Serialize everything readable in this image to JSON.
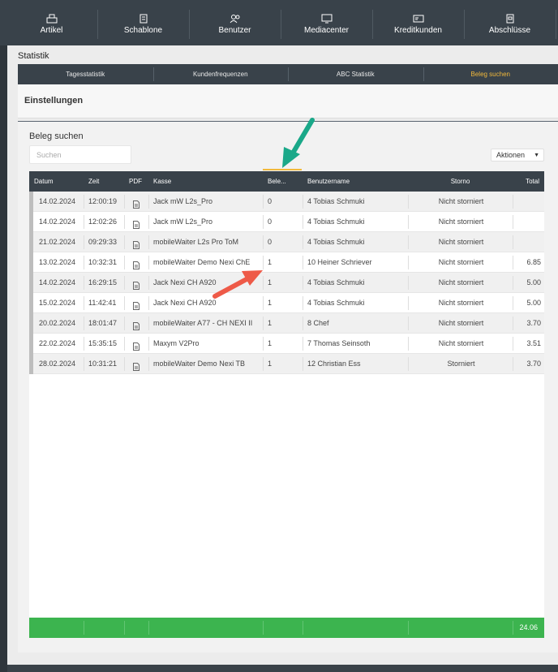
{
  "nav": [
    {
      "label": "Artikel",
      "icon": "register-icon"
    },
    {
      "label": "Schablone",
      "icon": "template-icon"
    },
    {
      "label": "Benutzer",
      "icon": "users-icon"
    },
    {
      "label": "Mediacenter",
      "icon": "media-icon"
    },
    {
      "label": "Kreditkunden",
      "icon": "id-card-icon"
    },
    {
      "label": "Abschlüsse",
      "icon": "report-icon"
    }
  ],
  "page_title": "Statistik",
  "tabs": [
    "Tagesstatistik",
    "Kundenfrequenzen",
    "ABC Statistik",
    "Beleg suchen"
  ],
  "active_tab": "Beleg suchen",
  "settings_title": "Einstellungen",
  "section_title": "Beleg suchen",
  "search_placeholder": "Suchen",
  "actions_label": "Aktionen",
  "columns": [
    "Datum",
    "Zeit",
    "PDF",
    "Kasse",
    "Bele...",
    "Benutzername",
    "Storno",
    "Total"
  ],
  "rows": [
    {
      "datum": "14.02.2024",
      "zeit": "12:00:19",
      "kasse": "Jack mW L2s_Pro",
      "beleg": "0",
      "user": "4 Tobias Schmuki",
      "storno": "Nicht storniert",
      "total": ""
    },
    {
      "datum": "14.02.2024",
      "zeit": "12:02:26",
      "kasse": "Jack mW L2s_Pro",
      "beleg": "0",
      "user": "4 Tobias Schmuki",
      "storno": "Nicht storniert",
      "total": ""
    },
    {
      "datum": "21.02.2024",
      "zeit": "09:29:33",
      "kasse": "mobileWaiter L2s Pro ToM",
      "beleg": "0",
      "user": "4 Tobias Schmuki",
      "storno": "Nicht storniert",
      "total": ""
    },
    {
      "datum": "13.02.2024",
      "zeit": "10:32:31",
      "kasse": "mobileWaiter Demo Nexi ChE",
      "beleg": "1",
      "user": "10 Heiner Schriever",
      "storno": "Nicht storniert",
      "total": "6.85"
    },
    {
      "datum": "14.02.2024",
      "zeit": "16:29:15",
      "kasse": "Jack Nexi CH A920",
      "beleg": "1",
      "user": "4 Tobias Schmuki",
      "storno": "Nicht storniert",
      "total": "5.00"
    },
    {
      "datum": "15.02.2024",
      "zeit": "11:42:41",
      "kasse": "Jack Nexi CH A920",
      "beleg": "1",
      "user": "4 Tobias Schmuki",
      "storno": "Nicht storniert",
      "total": "5.00"
    },
    {
      "datum": "20.02.2024",
      "zeit": "18:01:47",
      "kasse": "mobileWaiter A77 - CH NEXI II",
      "beleg": "1",
      "user": "8 Chef",
      "storno": "Nicht storniert",
      "total": "3.70"
    },
    {
      "datum": "22.02.2024",
      "zeit": "15:35:15",
      "kasse": "Maxym V2Pro",
      "beleg": "1",
      "user": "7 Thomas Seinsoth",
      "storno": "Nicht storniert",
      "total": "3.51"
    },
    {
      "datum": "28.02.2024",
      "zeit": "10:31:21",
      "kasse": "mobileWaiter Demo Nexi TB",
      "beleg": "1",
      "user": "12 Christian Ess",
      "storno": "Storniert",
      "total": "3.70"
    }
  ],
  "footer_total": "24.06",
  "colors": {
    "accent": "#f2b93b",
    "header": "#39424a",
    "footer": "#3cb44f",
    "arrow_teal": "#1aa889",
    "arrow_red": "#ee5a48"
  }
}
